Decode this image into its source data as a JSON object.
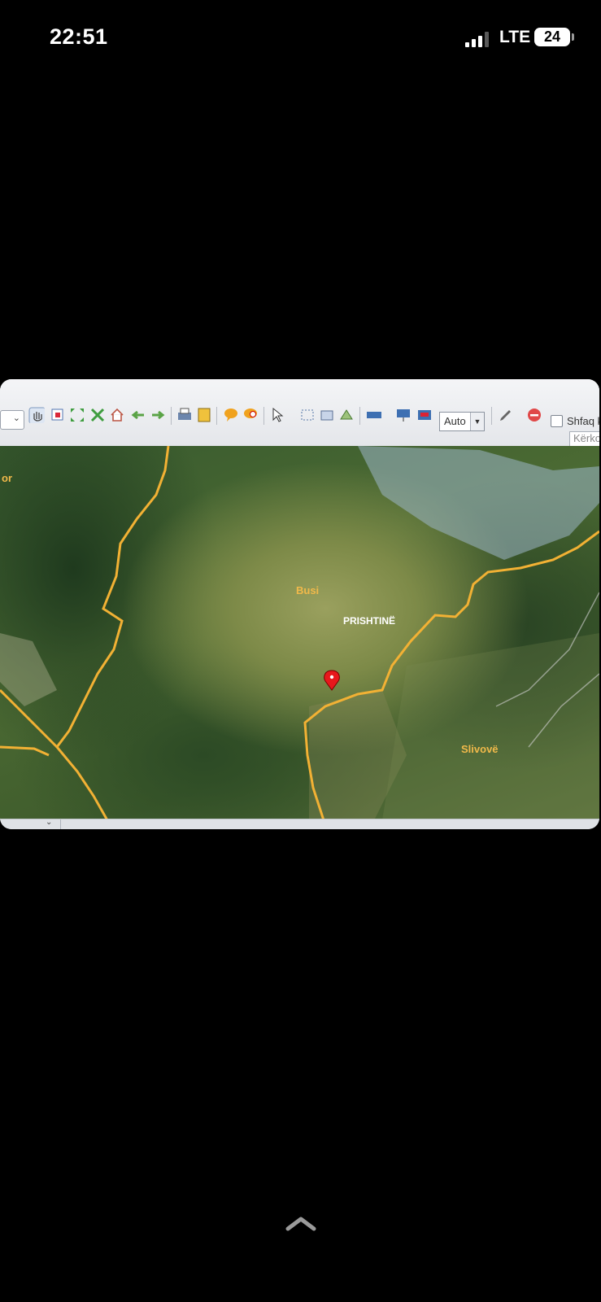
{
  "status_bar": {
    "time": "22:51",
    "network": "LTE",
    "battery": "24"
  },
  "toolbar": {
    "zoom_value": "Auto",
    "show_label": "Shfaq k",
    "search_placeholder": "Kërko"
  },
  "map": {
    "labels": {
      "busi": "Busi",
      "prishtine": "PRISHTINË",
      "slivove": "Slivovë",
      "edge_left": "or"
    },
    "colors": {
      "boundary": "#f2b134",
      "pin": "#e8181c"
    }
  },
  "icons": [
    "hand-pan-icon",
    "zoom-box-icon",
    "full-extent-icon",
    "zoom-extent-icon",
    "home-icon",
    "back-arrow-icon",
    "forward-arrow-icon",
    "print-icon",
    "export-icon",
    "comment-icon",
    "comment-edit-icon",
    "select-arrow-icon",
    "select-features-icon",
    "layer-icon",
    "layer-edit-icon",
    "measure-icon",
    "map-icon",
    "map-settings-icon",
    "pencil-icon",
    "stop-icon"
  ]
}
